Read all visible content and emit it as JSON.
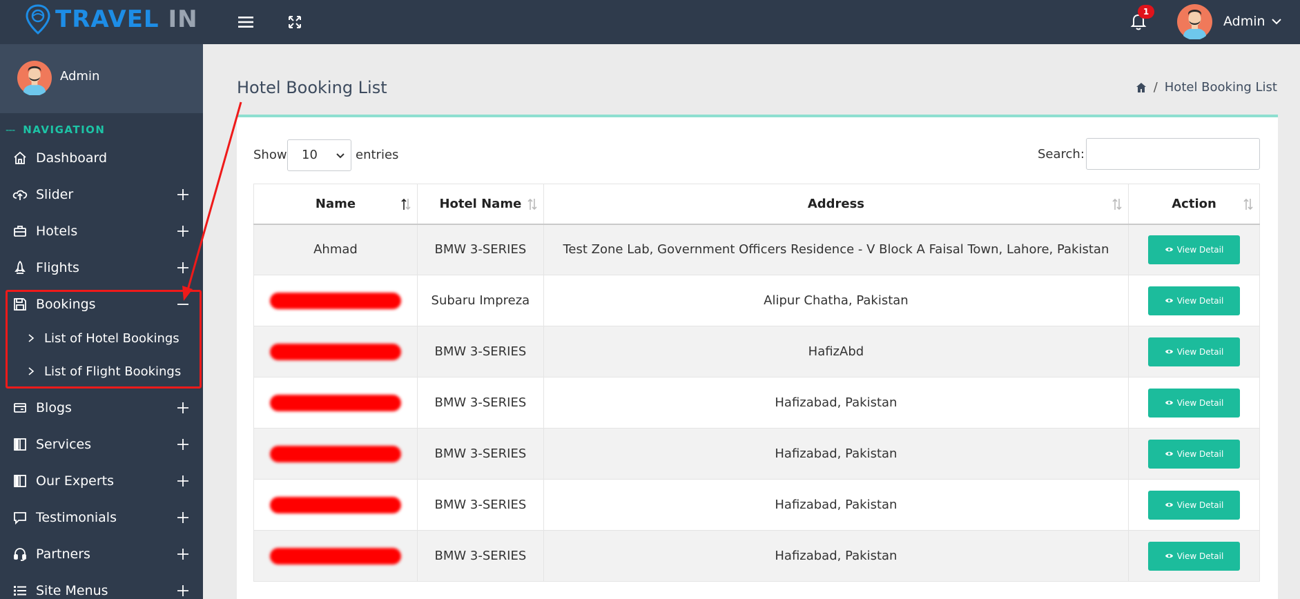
{
  "app": {
    "logo_part1": "TRAVEL",
    "logo_part2": "IN",
    "notification_count": "1",
    "user_name": "Admin"
  },
  "sidebar": {
    "profile_name": "Admin",
    "nav_title": "NAVIGATION",
    "items": [
      {
        "label": "Dashboard",
        "icon": "home-icon"
      },
      {
        "label": "Slider",
        "icon": "cloud-upload-icon"
      },
      {
        "label": "Hotels",
        "icon": "briefcase-icon"
      },
      {
        "label": "Flights",
        "icon": "rocket-icon"
      },
      {
        "label": "Bookings",
        "icon": "save-icon"
      },
      {
        "label": "Blogs",
        "icon": "card-icon"
      },
      {
        "label": "Services",
        "icon": "book-icon"
      },
      {
        "label": "Our Experts",
        "icon": "book-icon"
      },
      {
        "label": "Testimonials",
        "icon": "comment-icon"
      },
      {
        "label": "Partners",
        "icon": "headset-icon"
      },
      {
        "label": "Site Menus",
        "icon": "list-icon"
      }
    ],
    "sub_items": [
      {
        "label": "List of Hotel Bookings"
      },
      {
        "label": "List of Flight Bookings"
      }
    ]
  },
  "page": {
    "title": "Hotel Booking List",
    "breadcrumb_current": "Hotel Booking List"
  },
  "table_controls": {
    "show_label": "Show",
    "entries_value": "10",
    "entries_label": "entries",
    "search_label": "Search:"
  },
  "table": {
    "columns": [
      "Name",
      "Hotel Name",
      "Address",
      "Action"
    ],
    "rows": [
      {
        "name": "Ahmad",
        "hotel": "BMW 3-SERIES",
        "address": "Test Zone Lab, Government Officers Residence - V Block A Faisal Town, Lahore, Pakistan",
        "action": "View Detail"
      },
      {
        "name": "",
        "hotel": "Subaru Impreza",
        "address": "Alipur Chatha, Pakistan",
        "action": "View Detail"
      },
      {
        "name": "",
        "hotel": "BMW 3-SERIES",
        "address": "HafizAbd",
        "action": "View Detail"
      },
      {
        "name": "",
        "hotel": "BMW 3-SERIES",
        "address": "Hafizabad, Pakistan",
        "action": "View Detail"
      },
      {
        "name": "",
        "hotel": "BMW 3-SERIES",
        "address": "Hafizabad, Pakistan",
        "action": "View Detail"
      },
      {
        "name": "",
        "hotel": "BMW 3-SERIES",
        "address": "Hafizabad, Pakistan",
        "action": "View Detail"
      },
      {
        "name": "",
        "hotel": "BMW 3-SERIES",
        "address": "Hafizabad, Pakistan",
        "action": "View Detail"
      }
    ]
  },
  "colors": {
    "topbar": "#2f3b4c",
    "accent": "#1cbc9c",
    "highlight": "#ef1a1a",
    "logo_blue": "#1d8de6"
  }
}
